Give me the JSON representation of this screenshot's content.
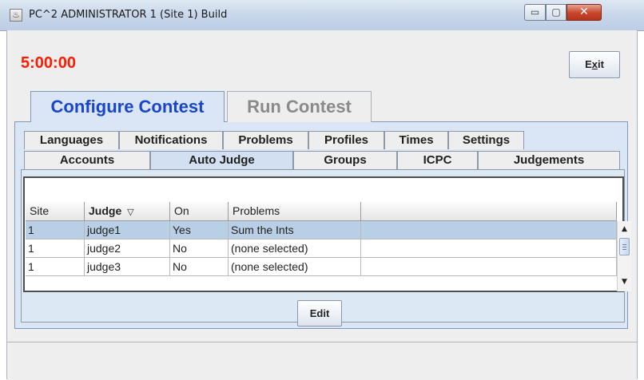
{
  "window": {
    "title": "PC^2 ADMINISTRATOR 1 (Site 1) Build",
    "controls": {
      "minimize": "▭",
      "maximize": "▢",
      "close": "✕"
    }
  },
  "header": {
    "clock": "5:00:00",
    "exit_label": "Exit"
  },
  "main_tabs": [
    {
      "label": "Configure Contest",
      "active": true
    },
    {
      "label": "Run Contest",
      "active": false
    }
  ],
  "sub_tabs_row1": [
    "Languages",
    "Notifications",
    "Problems",
    "Profiles",
    "Times",
    "Settings"
  ],
  "sub_tabs_row2": [
    "Accounts",
    "Auto Judge",
    "Groups",
    "ICPC",
    "Judgements"
  ],
  "active_sub_tab": "Auto Judge",
  "table": {
    "columns": [
      "Site",
      "Judge",
      "On",
      "Problems"
    ],
    "sort_indicator": "▽",
    "rows": [
      {
        "site": "1",
        "judge": "judge1",
        "on": "Yes",
        "problems": "Sum the Ints",
        "selected": true
      },
      {
        "site": "1",
        "judge": "judge2",
        "on": "No",
        "problems": "(none selected)",
        "selected": false
      },
      {
        "site": "1",
        "judge": "judge3",
        "on": "No",
        "problems": "(none selected)",
        "selected": false
      }
    ]
  },
  "edit_label": "Edit",
  "colors": {
    "clock": "#ff1a00",
    "active_tab_text": "#1946c9",
    "selected_row": "#b8cfe5",
    "panel": "#dae6f5"
  }
}
